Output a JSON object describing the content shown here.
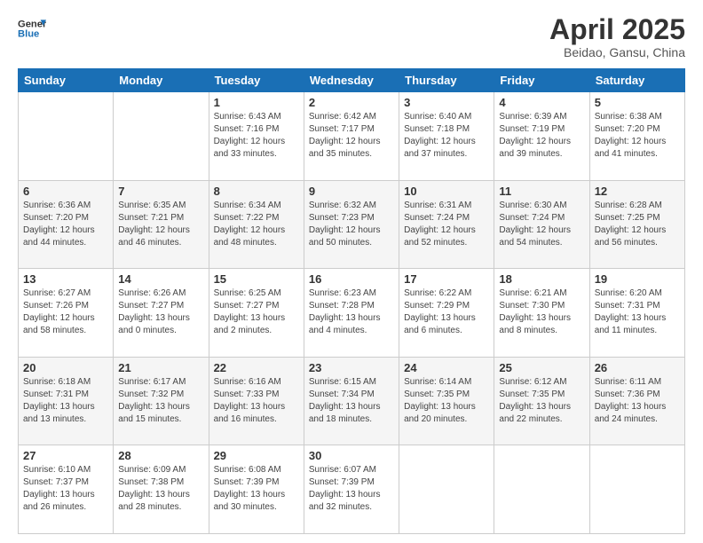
{
  "logo": {
    "line1": "General",
    "line2": "Blue"
  },
  "title": "April 2025",
  "subtitle": "Beidao, Gansu, China",
  "days_of_week": [
    "Sunday",
    "Monday",
    "Tuesday",
    "Wednesday",
    "Thursday",
    "Friday",
    "Saturday"
  ],
  "weeks": [
    [
      {
        "day": "",
        "info": ""
      },
      {
        "day": "",
        "info": ""
      },
      {
        "day": "1",
        "info": "Sunrise: 6:43 AM\nSunset: 7:16 PM\nDaylight: 12 hours\nand 33 minutes."
      },
      {
        "day": "2",
        "info": "Sunrise: 6:42 AM\nSunset: 7:17 PM\nDaylight: 12 hours\nand 35 minutes."
      },
      {
        "day": "3",
        "info": "Sunrise: 6:40 AM\nSunset: 7:18 PM\nDaylight: 12 hours\nand 37 minutes."
      },
      {
        "day": "4",
        "info": "Sunrise: 6:39 AM\nSunset: 7:19 PM\nDaylight: 12 hours\nand 39 minutes."
      },
      {
        "day": "5",
        "info": "Sunrise: 6:38 AM\nSunset: 7:20 PM\nDaylight: 12 hours\nand 41 minutes."
      }
    ],
    [
      {
        "day": "6",
        "info": "Sunrise: 6:36 AM\nSunset: 7:20 PM\nDaylight: 12 hours\nand 44 minutes."
      },
      {
        "day": "7",
        "info": "Sunrise: 6:35 AM\nSunset: 7:21 PM\nDaylight: 12 hours\nand 46 minutes."
      },
      {
        "day": "8",
        "info": "Sunrise: 6:34 AM\nSunset: 7:22 PM\nDaylight: 12 hours\nand 48 minutes."
      },
      {
        "day": "9",
        "info": "Sunrise: 6:32 AM\nSunset: 7:23 PM\nDaylight: 12 hours\nand 50 minutes."
      },
      {
        "day": "10",
        "info": "Sunrise: 6:31 AM\nSunset: 7:24 PM\nDaylight: 12 hours\nand 52 minutes."
      },
      {
        "day": "11",
        "info": "Sunrise: 6:30 AM\nSunset: 7:24 PM\nDaylight: 12 hours\nand 54 minutes."
      },
      {
        "day": "12",
        "info": "Sunrise: 6:28 AM\nSunset: 7:25 PM\nDaylight: 12 hours\nand 56 minutes."
      }
    ],
    [
      {
        "day": "13",
        "info": "Sunrise: 6:27 AM\nSunset: 7:26 PM\nDaylight: 12 hours\nand 58 minutes."
      },
      {
        "day": "14",
        "info": "Sunrise: 6:26 AM\nSunset: 7:27 PM\nDaylight: 13 hours\nand 0 minutes."
      },
      {
        "day": "15",
        "info": "Sunrise: 6:25 AM\nSunset: 7:27 PM\nDaylight: 13 hours\nand 2 minutes."
      },
      {
        "day": "16",
        "info": "Sunrise: 6:23 AM\nSunset: 7:28 PM\nDaylight: 13 hours\nand 4 minutes."
      },
      {
        "day": "17",
        "info": "Sunrise: 6:22 AM\nSunset: 7:29 PM\nDaylight: 13 hours\nand 6 minutes."
      },
      {
        "day": "18",
        "info": "Sunrise: 6:21 AM\nSunset: 7:30 PM\nDaylight: 13 hours\nand 8 minutes."
      },
      {
        "day": "19",
        "info": "Sunrise: 6:20 AM\nSunset: 7:31 PM\nDaylight: 13 hours\nand 11 minutes."
      }
    ],
    [
      {
        "day": "20",
        "info": "Sunrise: 6:18 AM\nSunset: 7:31 PM\nDaylight: 13 hours\nand 13 minutes."
      },
      {
        "day": "21",
        "info": "Sunrise: 6:17 AM\nSunset: 7:32 PM\nDaylight: 13 hours\nand 15 minutes."
      },
      {
        "day": "22",
        "info": "Sunrise: 6:16 AM\nSunset: 7:33 PM\nDaylight: 13 hours\nand 16 minutes."
      },
      {
        "day": "23",
        "info": "Sunrise: 6:15 AM\nSunset: 7:34 PM\nDaylight: 13 hours\nand 18 minutes."
      },
      {
        "day": "24",
        "info": "Sunrise: 6:14 AM\nSunset: 7:35 PM\nDaylight: 13 hours\nand 20 minutes."
      },
      {
        "day": "25",
        "info": "Sunrise: 6:12 AM\nSunset: 7:35 PM\nDaylight: 13 hours\nand 22 minutes."
      },
      {
        "day": "26",
        "info": "Sunrise: 6:11 AM\nSunset: 7:36 PM\nDaylight: 13 hours\nand 24 minutes."
      }
    ],
    [
      {
        "day": "27",
        "info": "Sunrise: 6:10 AM\nSunset: 7:37 PM\nDaylight: 13 hours\nand 26 minutes."
      },
      {
        "day": "28",
        "info": "Sunrise: 6:09 AM\nSunset: 7:38 PM\nDaylight: 13 hours\nand 28 minutes."
      },
      {
        "day": "29",
        "info": "Sunrise: 6:08 AM\nSunset: 7:39 PM\nDaylight: 13 hours\nand 30 minutes."
      },
      {
        "day": "30",
        "info": "Sunrise: 6:07 AM\nSunset: 7:39 PM\nDaylight: 13 hours\nand 32 minutes."
      },
      {
        "day": "",
        "info": ""
      },
      {
        "day": "",
        "info": ""
      },
      {
        "day": "",
        "info": ""
      }
    ]
  ]
}
